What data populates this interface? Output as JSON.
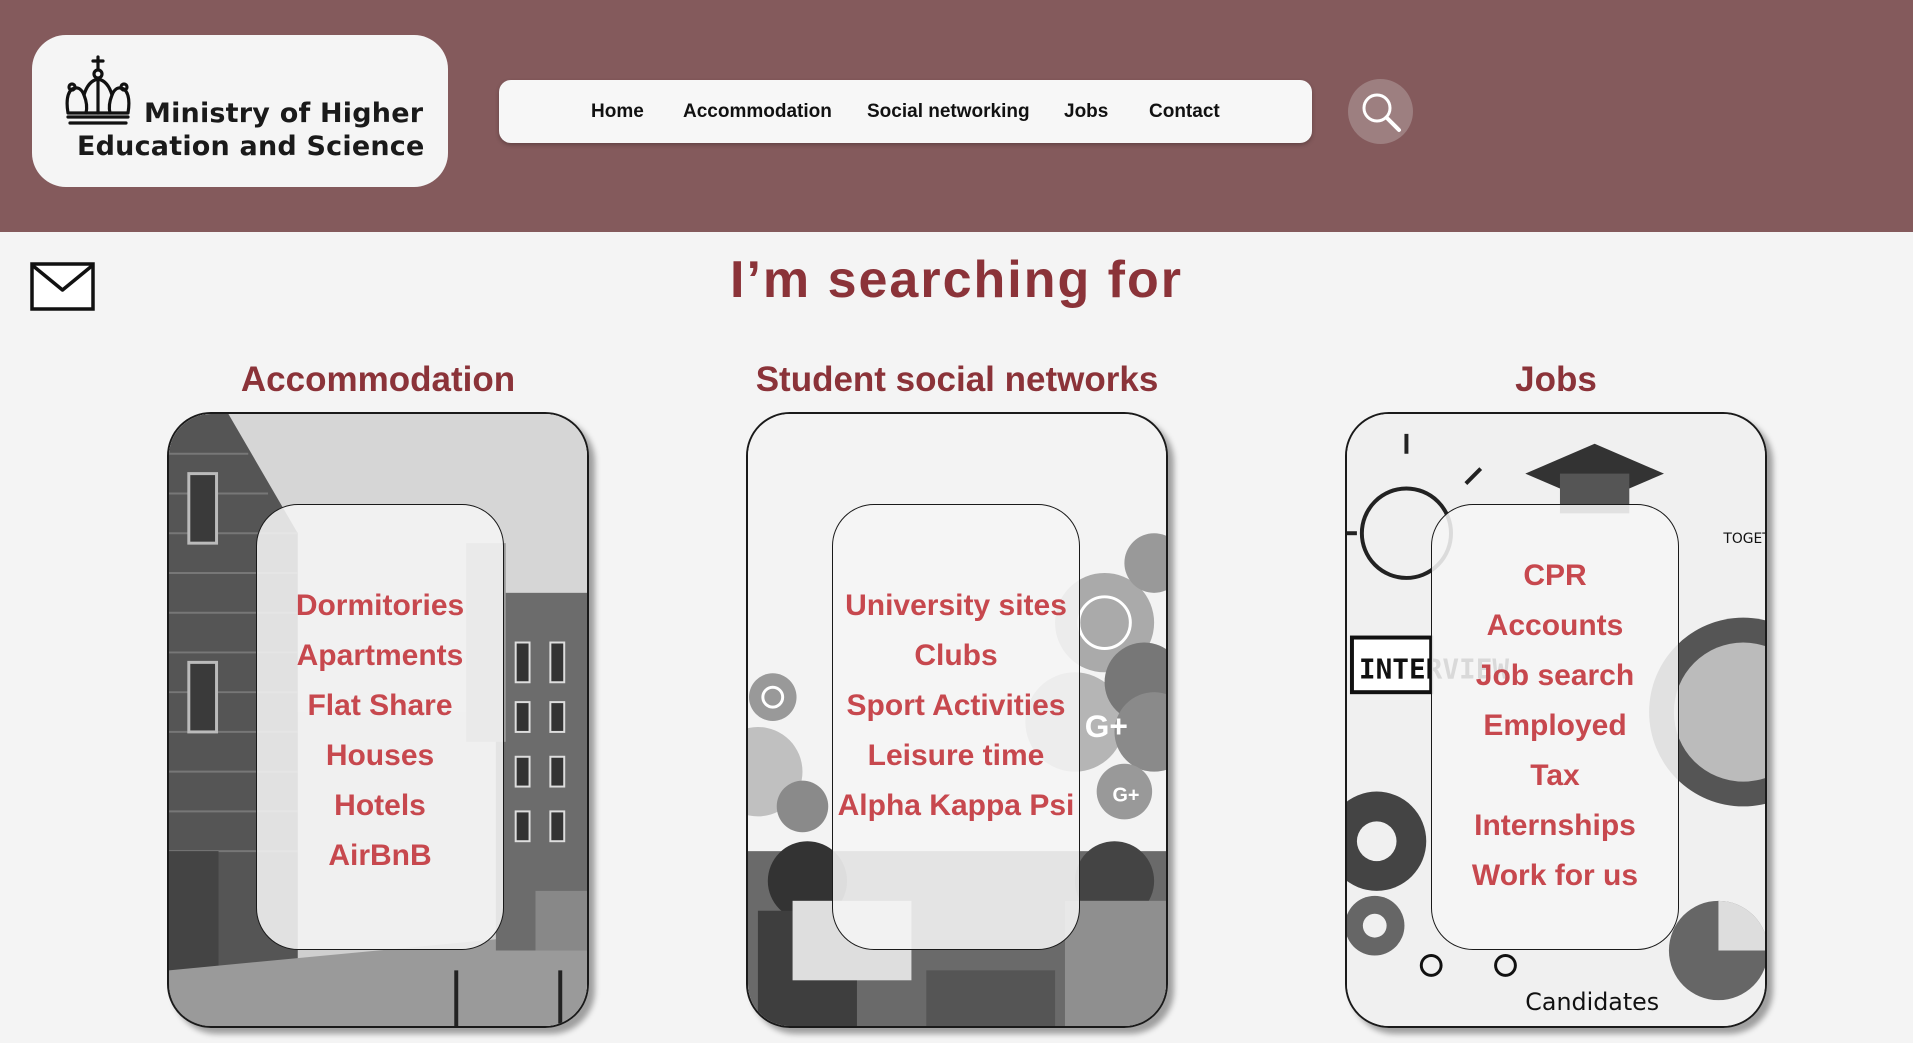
{
  "brand": {
    "line1": "Ministry of Higher",
    "line2": "Education and Science"
  },
  "nav": {
    "items": [
      "Home",
      "Accommodation",
      "Social networking",
      "Jobs",
      "Contact"
    ]
  },
  "page": {
    "title": "I’m searching for"
  },
  "columns": [
    {
      "title": "Accommodation",
      "items": [
        "Dormitories",
        "Apartments",
        "Flat Share",
        "Houses",
        "Hotels",
        "AirBnB"
      ]
    },
    {
      "title": "Student social networks",
      "items": [
        "University sites",
        "Clubs",
        "Sport Activities",
        "Leisure time",
        "Alpha Kappa Psi"
      ]
    },
    {
      "title": "Jobs",
      "items": [
        "CPR",
        "Accounts",
        "Job search",
        "Employed",
        "Tax",
        "Internships",
        "Work for us"
      ]
    }
  ],
  "image_text": {
    "jobs_candidates": "Candidates",
    "jobs_interview": "INTERVIEW",
    "jobs_together": "TOGET"
  },
  "colors": {
    "header": "#845a5c",
    "title": "#8b3339",
    "link": "#c7484e",
    "background": "#f4f4f4"
  },
  "icons": {
    "logo": "crown-icon",
    "search": "search-icon",
    "mail": "envelope-icon"
  }
}
